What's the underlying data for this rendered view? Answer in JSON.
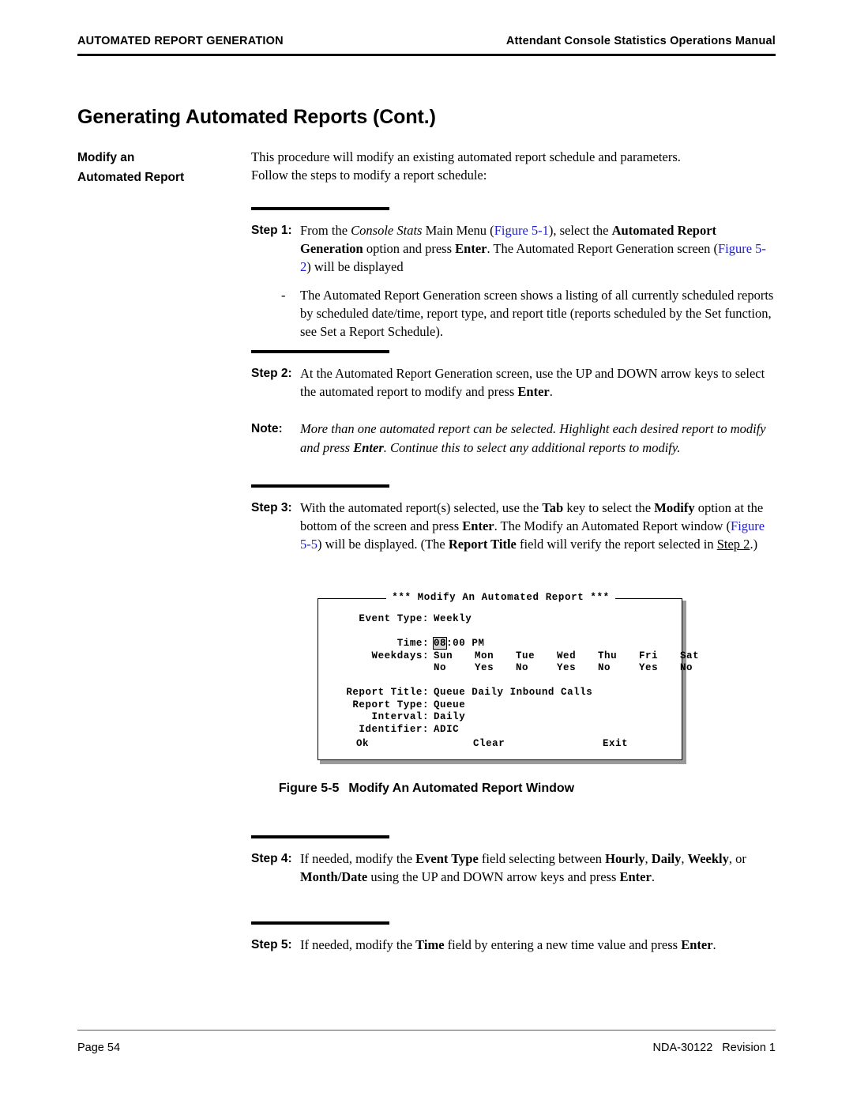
{
  "header": {
    "left": "AUTOMATED REPORT GENERATION",
    "right": "Attendant Console Statistics Operations Manual"
  },
  "page_title": "Generating Automated Reports (Cont.)",
  "side_heading": {
    "line1": "Modify an",
    "line2": "Automated Report"
  },
  "intro": {
    "line1": "This procedure will modify an existing automated report schedule and parameters.",
    "line2": "Follow the steps to modify a report schedule:"
  },
  "steps": {
    "step1": {
      "label": "Step 1:",
      "text_a": "From the ",
      "italic_a": "Console Stats",
      "text_b": " Main Menu (",
      "xref_a": "Figure 5-1",
      "text_c": "), select the ",
      "bold_a": "Automated Report Generation",
      "text_d": " option and press ",
      "bold_b": "Enter",
      "text_e": ". The Automated Report Generation screen (",
      "xref_b": "Figure 5-2",
      "text_f": ") will be displayed",
      "bullet_dash": "-",
      "bullet_text": "The Automated Report Generation screen shows a listing of all currently scheduled reports by scheduled date/time, report type, and report title (reports scheduled by the Set function, see Set a Report Schedule)."
    },
    "step2": {
      "label": "Step 2:",
      "text_a": "At the Automated Report Generation screen, use the UP and DOWN arrow keys to select the automated report to modify and press ",
      "bold_a": "Enter",
      "text_b": "."
    },
    "note": {
      "label": "Note:",
      "text_a": "More than one automated report can be selected. Highlight each desired report to modify and press ",
      "bold_a": "Enter",
      "text_b": ". Continue this to select any additional reports to modify."
    },
    "step3": {
      "label": "Step 3:",
      "text_a": "With the automated report(s) selected, use the ",
      "bold_a": "Tab",
      "text_b": " key to select the ",
      "bold_b": "Modify",
      "text_c": " option at the bottom of the screen and press ",
      "bold_c": "Enter",
      "text_d": ". The Modify an Automated Report window (",
      "xref_a": "Figure 5-5",
      "text_e": ") will be displayed. (The ",
      "bold_d": "Report Title",
      "text_f": " field will verify the report selected in ",
      "xref_b": "Step 2",
      "text_g": ".)"
    },
    "step4": {
      "label": "Step 4:",
      "text_a": "If needed, modify the ",
      "bold_a": "Event Type",
      "text_b": " field selecting between ",
      "bold_b": "Hourly",
      "text_c": ", ",
      "bold_c": "Daily",
      "text_d": ", ",
      "bold_d": "Weekly",
      "text_e": ", or ",
      "bold_e": "Month/Date",
      "text_f": " using the UP and DOWN arrow keys and press ",
      "bold_f": "Enter",
      "text_g": "."
    },
    "step5": {
      "label": "Step 5:",
      "text_a": "If needed, modify the ",
      "bold_a": "Time",
      "text_b": " field by entering a new time value and press ",
      "bold_b": "Enter",
      "text_c": "."
    }
  },
  "terminal": {
    "title": "*** Modify An Automated Report ***",
    "fields": {
      "event_type_label": "Event Type:",
      "event_type_value": "Weekly",
      "time_label": "Time:",
      "time_value_highlighted": "08",
      "time_value_rest": ":00 PM",
      "weekdays_label": "Weekdays:",
      "weekday_names": [
        "Sun",
        "Mon",
        "Tue",
        "Wed",
        "Thu",
        "Fri",
        "Sat"
      ],
      "weekday_values": [
        "No",
        "Yes",
        "No",
        "Yes",
        "No",
        "Yes",
        "No"
      ],
      "report_title_label": "Report Title:",
      "report_title_value": "Queue Daily Inbound Calls",
      "report_type_label": "Report Type:",
      "report_type_value": "Queue",
      "interval_label": "Interval:",
      "interval_value": "Daily",
      "identifier_label": "Identifier:",
      "identifier_value": "ADIC"
    },
    "buttons": {
      "ok": "Ok",
      "clear": "Clear",
      "exit": "Exit"
    }
  },
  "figure_caption": {
    "number": "Figure 5-5",
    "title": "Modify An Automated Report Window"
  },
  "footer": {
    "left": "Page 54",
    "doc_number": "NDA-30122",
    "revision": "Revision 1"
  },
  "colors": {
    "xref_blue": "#2020cc",
    "rule_black": "#000000",
    "highlight_gray": "#d4d4d4"
  }
}
